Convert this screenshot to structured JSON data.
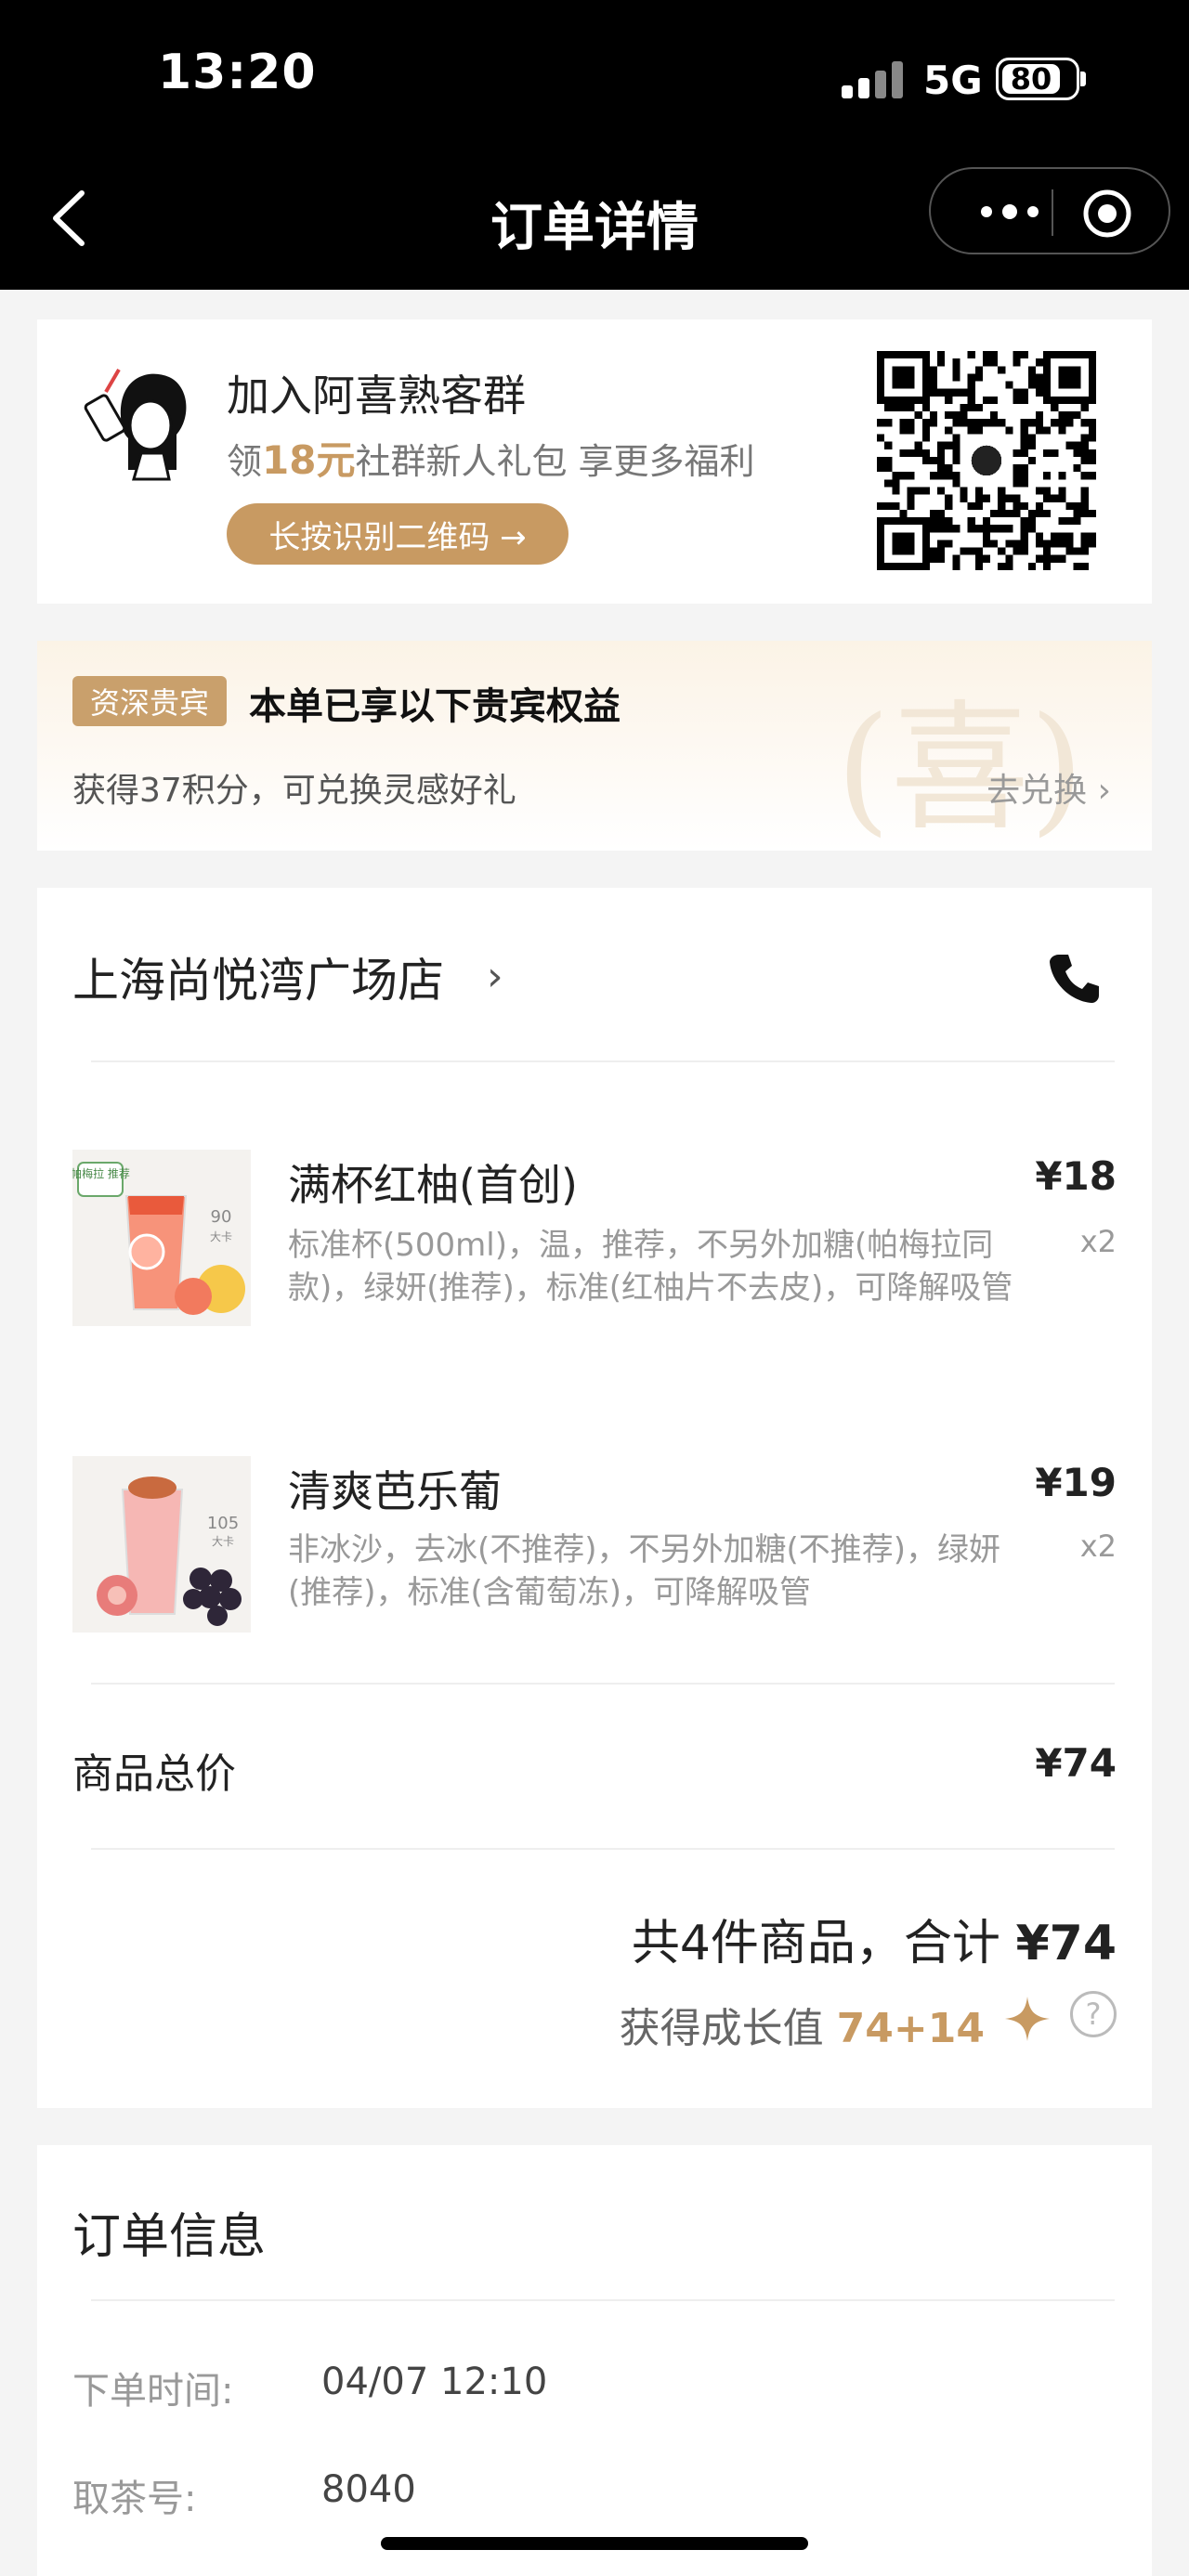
{
  "status_bar": {
    "time": "13:20",
    "network": "5G",
    "battery": "80"
  },
  "nav": {
    "title": "订单详情"
  },
  "promo": {
    "title": "加入阿喜熟客群",
    "sub_prefix": "领",
    "sub_highlight": "18元",
    "sub_suffix": "社群新人礼包 享更多福利",
    "button": "长按识别二维码 →"
  },
  "vip": {
    "badge": "资深贵宾",
    "title": "本单已享以下贵宾权益",
    "desc": "获得37积分，可兑换灵感好礼",
    "link": "去兑换 ›",
    "seal": "(喜)"
  },
  "order": {
    "store": "上海尚悦湾广场店",
    "items": [
      {
        "name": "满杯红柚(首创)",
        "spec": "标准杯(500ml)，温，推荐，不另外加糖(帕梅拉同款)，绿妍(推荐)，标准(红柚片不去皮)，可降解吸管",
        "price": "¥18",
        "qty": "x2",
        "thumb_tag": "帕梅拉 推荐",
        "thumb_kcal": "90",
        "thumb_cup": "大卡"
      },
      {
        "name": "清爽芭乐葡",
        "spec": "非冰沙，去冰(不推荐)，不另外加糖(不推荐)，绿妍(推荐)，标准(含葡萄冻)，可降解吸管",
        "price": "¥19",
        "qty": "x2",
        "thumb_kcal": "105",
        "thumb_cup": "大卡"
      }
    ],
    "subtotal_label": "商品总价",
    "subtotal_value": "¥74",
    "summary_prefix": "共4件商品，合计 ",
    "summary_amount": "¥74",
    "growth_label": "获得成长值 ",
    "growth_value": "74+14",
    "help": "?"
  },
  "info": {
    "title": "订单信息",
    "rows": [
      {
        "label": "下单时间:",
        "value": "04/07 12:10"
      },
      {
        "label": "取茶号:",
        "value": "8040"
      }
    ]
  }
}
